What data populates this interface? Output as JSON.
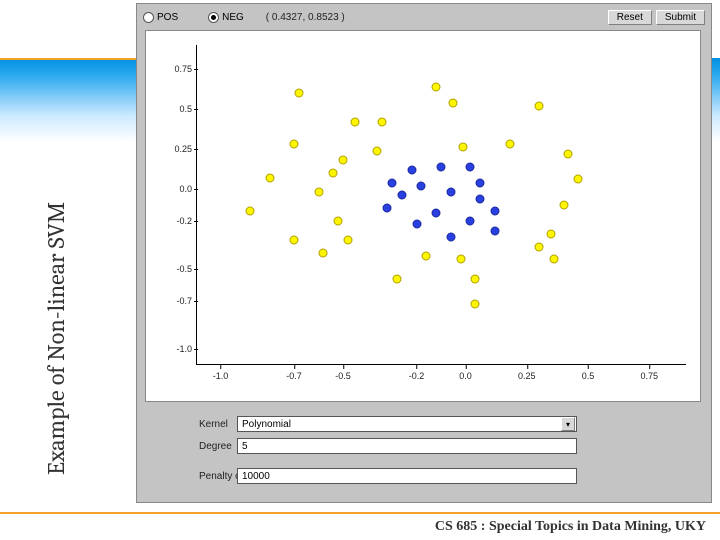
{
  "slide": {
    "side_title": "Example of Non-linear SVM",
    "footer": "CS 685 : Special Topics in Data Mining, UKY"
  },
  "toolbar": {
    "pos_label": "POS",
    "neg_label": "NEG",
    "coord": "( 0.4327, 0.8523 )",
    "reset_label": "Reset",
    "submit_label": "Submit",
    "selected": "neg"
  },
  "form": {
    "kernel_label": "Kernel",
    "kernel_value": "Polynomial",
    "degree_label": "Degree",
    "degree_value": "5",
    "penalty_label": "Penalty on Error",
    "penalty_value": "10000"
  },
  "chart_data": {
    "type": "scatter",
    "title": "",
    "xlabel": "",
    "ylabel": "",
    "x_ticks": [
      -1.0,
      -0.7,
      -0.5,
      -0.2,
      0.0,
      0.25,
      0.5,
      0.75
    ],
    "y_ticks": [
      -1.0,
      -0.7,
      -0.5,
      -0.2,
      0.0,
      0.25,
      0.5,
      0.75
    ],
    "xlim": [
      -1.1,
      0.9
    ],
    "ylim": [
      -1.1,
      0.9
    ],
    "series": [
      {
        "name": "POS",
        "color": "#fff600",
        "points": [
          {
            "x": -0.68,
            "y": 0.6
          },
          {
            "x": -0.12,
            "y": 0.64
          },
          {
            "x": -0.05,
            "y": 0.54
          },
          {
            "x": 0.3,
            "y": 0.52
          },
          {
            "x": -0.45,
            "y": 0.42
          },
          {
            "x": -0.34,
            "y": 0.42
          },
          {
            "x": -0.7,
            "y": 0.28
          },
          {
            "x": -0.36,
            "y": 0.24
          },
          {
            "x": -0.01,
            "y": 0.26
          },
          {
            "x": 0.18,
            "y": 0.28
          },
          {
            "x": 0.42,
            "y": 0.22
          },
          {
            "x": -0.8,
            "y": 0.07
          },
          {
            "x": -0.54,
            "y": 0.1
          },
          {
            "x": -0.5,
            "y": 0.18
          },
          {
            "x": 0.46,
            "y": 0.06
          },
          {
            "x": -0.6,
            "y": -0.02
          },
          {
            "x": -0.88,
            "y": -0.14
          },
          {
            "x": -0.52,
            "y": -0.2
          },
          {
            "x": 0.4,
            "y": -0.1
          },
          {
            "x": -0.7,
            "y": -0.32
          },
          {
            "x": -0.58,
            "y": -0.4
          },
          {
            "x": -0.48,
            "y": -0.32
          },
          {
            "x": -0.16,
            "y": -0.42
          },
          {
            "x": -0.02,
            "y": -0.44
          },
          {
            "x": 0.3,
            "y": -0.36
          },
          {
            "x": 0.35,
            "y": -0.28
          },
          {
            "x": 0.36,
            "y": -0.44
          },
          {
            "x": -0.28,
            "y": -0.56
          },
          {
            "x": 0.04,
            "y": -0.56
          },
          {
            "x": 0.04,
            "y": -0.72
          }
        ]
      },
      {
        "name": "NEG",
        "color": "#2a3fe0",
        "points": [
          {
            "x": -0.22,
            "y": 0.12
          },
          {
            "x": -0.1,
            "y": 0.14
          },
          {
            "x": 0.02,
            "y": 0.14
          },
          {
            "x": -0.3,
            "y": 0.04
          },
          {
            "x": -0.18,
            "y": 0.02
          },
          {
            "x": 0.06,
            "y": 0.04
          },
          {
            "x": -0.26,
            "y": -0.04
          },
          {
            "x": -0.06,
            "y": -0.02
          },
          {
            "x": 0.06,
            "y": -0.06
          },
          {
            "x": -0.32,
            "y": -0.12
          },
          {
            "x": -0.12,
            "y": -0.15
          },
          {
            "x": -0.2,
            "y": -0.22
          },
          {
            "x": 0.02,
            "y": -0.2
          },
          {
            "x": 0.12,
            "y": -0.14
          },
          {
            "x": -0.06,
            "y": -0.3
          },
          {
            "x": 0.12,
            "y": -0.26
          }
        ]
      }
    ]
  }
}
